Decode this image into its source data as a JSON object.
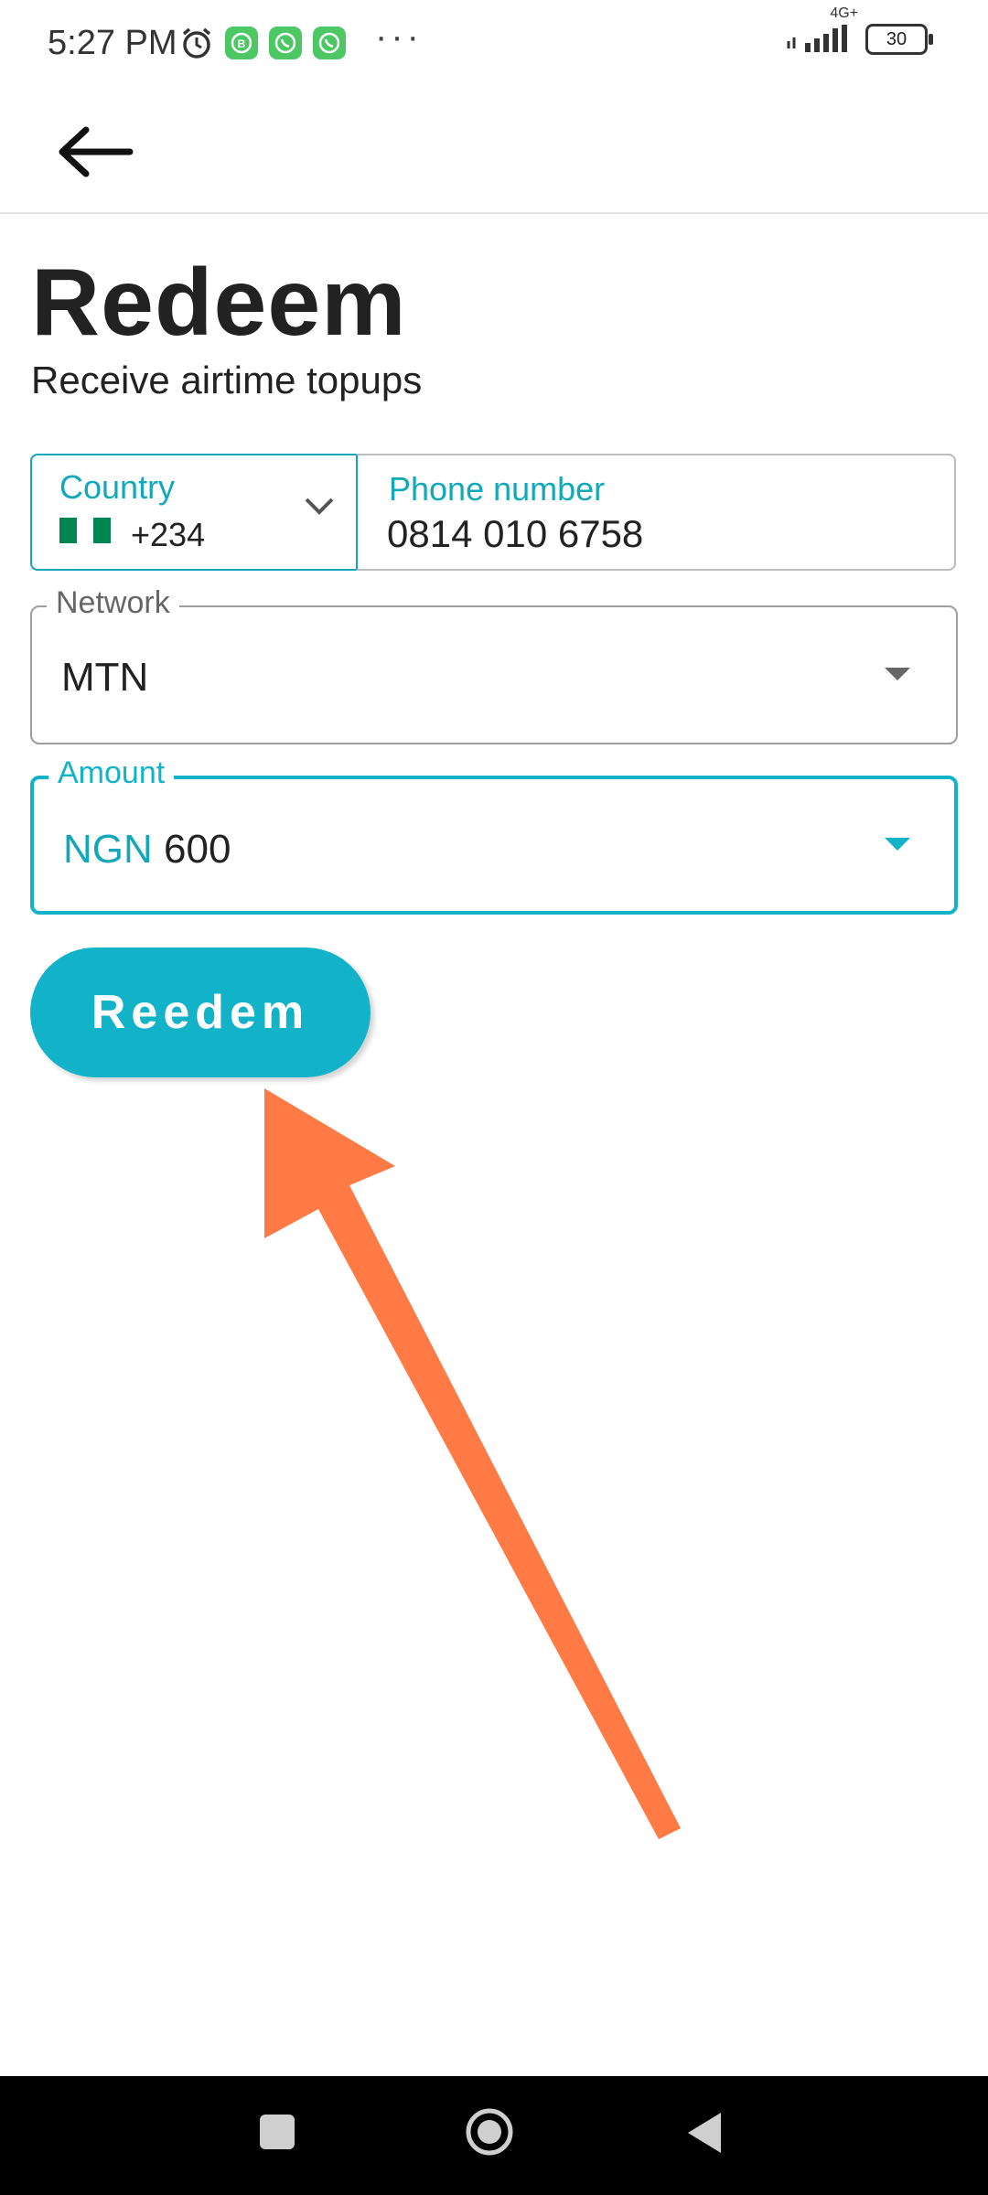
{
  "status_bar": {
    "time": "5:27 PM",
    "network": "4G+",
    "battery": "30",
    "icons": [
      "alarm-icon",
      "whatsapp-business-icon",
      "whatsapp-icon",
      "whatsapp-icon",
      "more-dots-icon",
      "signal-icon",
      "battery-icon"
    ]
  },
  "header": {
    "back_icon": "arrow-left-icon"
  },
  "page": {
    "title": "Redeem",
    "subtitle": "Receive airtime topups"
  },
  "form": {
    "country": {
      "label": "Country",
      "code": "+234",
      "flag_colors": [
        "#008751",
        "#ffffff",
        "#008751"
      ]
    },
    "phone": {
      "label": "Phone number",
      "value": "0814 010 6758"
    },
    "network": {
      "label": "Network",
      "value": "MTN"
    },
    "amount": {
      "label": "Amount",
      "currency": "NGN",
      "value": "600"
    }
  },
  "actions": {
    "redeem_label": "Reedem"
  },
  "colors": {
    "accent": "#12b3c8",
    "annotation_arrow": "#ff7a45"
  },
  "nav_bar": {
    "icons": [
      "recents-square-icon",
      "home-circle-icon",
      "back-triangle-icon"
    ]
  }
}
